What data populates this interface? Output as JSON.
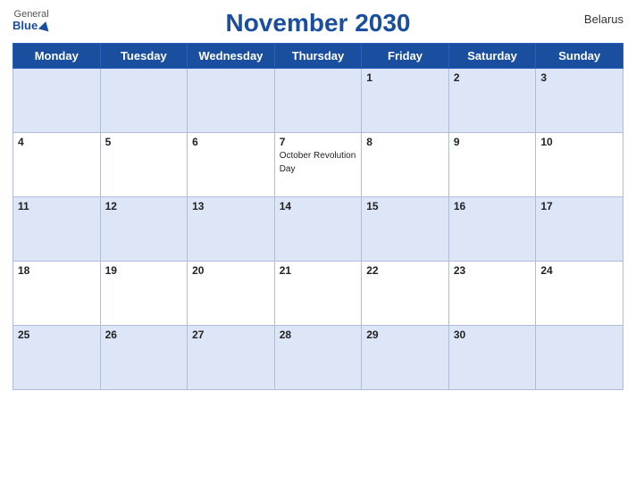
{
  "header": {
    "title": "November 2030",
    "country": "Belarus",
    "logo_general": "General",
    "logo_blue": "Blue"
  },
  "weekdays": [
    "Monday",
    "Tuesday",
    "Wednesday",
    "Thursday",
    "Friday",
    "Saturday",
    "Sunday"
  ],
  "weeks": [
    [
      {
        "day": "",
        "holiday": ""
      },
      {
        "day": "",
        "holiday": ""
      },
      {
        "day": "",
        "holiday": ""
      },
      {
        "day": "",
        "holiday": ""
      },
      {
        "day": "1",
        "holiday": ""
      },
      {
        "day": "2",
        "holiday": ""
      },
      {
        "day": "3",
        "holiday": ""
      }
    ],
    [
      {
        "day": "4",
        "holiday": ""
      },
      {
        "day": "5",
        "holiday": ""
      },
      {
        "day": "6",
        "holiday": ""
      },
      {
        "day": "7",
        "holiday": "October Revolution Day"
      },
      {
        "day": "8",
        "holiday": ""
      },
      {
        "day": "9",
        "holiday": ""
      },
      {
        "day": "10",
        "holiday": ""
      }
    ],
    [
      {
        "day": "11",
        "holiday": ""
      },
      {
        "day": "12",
        "holiday": ""
      },
      {
        "day": "13",
        "holiday": ""
      },
      {
        "day": "14",
        "holiday": ""
      },
      {
        "day": "15",
        "holiday": ""
      },
      {
        "day": "16",
        "holiday": ""
      },
      {
        "day": "17",
        "holiday": ""
      }
    ],
    [
      {
        "day": "18",
        "holiday": ""
      },
      {
        "day": "19",
        "holiday": ""
      },
      {
        "day": "20",
        "holiday": ""
      },
      {
        "day": "21",
        "holiday": ""
      },
      {
        "day": "22",
        "holiday": ""
      },
      {
        "day": "23",
        "holiday": ""
      },
      {
        "day": "24",
        "holiday": ""
      }
    ],
    [
      {
        "day": "25",
        "holiday": ""
      },
      {
        "day": "26",
        "holiday": ""
      },
      {
        "day": "27",
        "holiday": ""
      },
      {
        "day": "28",
        "holiday": ""
      },
      {
        "day": "29",
        "holiday": ""
      },
      {
        "day": "30",
        "holiday": ""
      },
      {
        "day": "",
        "holiday": ""
      }
    ]
  ],
  "colors": {
    "header_bg": "#1a4fa0",
    "odd_row_bg": "#dce6f7",
    "even_row_bg": "#ffffff"
  }
}
